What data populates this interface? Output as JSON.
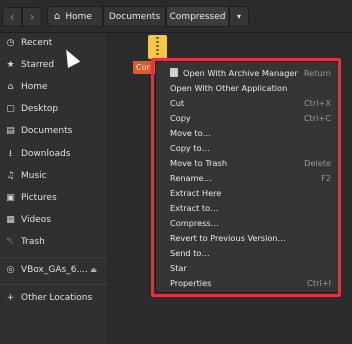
{
  "header": {
    "back_glyph": "‹",
    "forward_glyph": "›",
    "breadcrumbs": [
      {
        "label": "Home",
        "icon": "home-icon"
      },
      {
        "label": "Documents"
      },
      {
        "label": "Compressed"
      }
    ],
    "dropdown_glyph": "▾"
  },
  "sidebar": {
    "items": [
      {
        "label": "Recent",
        "icon": "clock-icon",
        "glyph": "◷"
      },
      {
        "label": "Starred",
        "icon": "star-icon",
        "glyph": "★"
      },
      {
        "label": "Home",
        "icon": "home-icon",
        "glyph": "⌂"
      },
      {
        "label": "Desktop",
        "icon": "desktop-icon",
        "glyph": "▢"
      },
      {
        "label": "Documents",
        "icon": "document-icon",
        "glyph": "▤"
      },
      {
        "label": "Downloads",
        "icon": "download-icon",
        "glyph": "⭳"
      },
      {
        "label": "Music",
        "icon": "music-icon",
        "glyph": "♫"
      },
      {
        "label": "Pictures",
        "icon": "picture-icon",
        "glyph": "▣"
      },
      {
        "label": "Videos",
        "icon": "video-icon",
        "glyph": "▦"
      },
      {
        "label": "Trash",
        "icon": "trash-icon",
        "glyph": "␡"
      }
    ],
    "device": {
      "label": "VBox_GAs_6....",
      "icon": "disc-icon",
      "glyph": "◎",
      "eject_glyph": "⏏"
    },
    "other_locations": {
      "label": "Other Locations",
      "glyph": "+"
    }
  },
  "content": {
    "selected_file_label": "Cor"
  },
  "context_menu": {
    "items": [
      {
        "label": "Open With Archive Manager",
        "shortcut": "Return",
        "icon": "archive-icon"
      },
      {
        "label": "Open With Other Application",
        "shortcut": ""
      },
      {
        "label": "Cut",
        "shortcut": "Ctrl+X"
      },
      {
        "label": "Copy",
        "shortcut": "Ctrl+C"
      },
      {
        "label": "Move to…",
        "shortcut": ""
      },
      {
        "label": "Copy to…",
        "shortcut": ""
      },
      {
        "label": "Move to Trash",
        "shortcut": "Delete"
      },
      {
        "label": "Rename…",
        "shortcut": "F2"
      },
      {
        "label": "Extract Here",
        "shortcut": ""
      },
      {
        "label": "Extract to…",
        "shortcut": ""
      },
      {
        "label": "Compress…",
        "shortcut": ""
      },
      {
        "label": "Revert to Previous Version…",
        "shortcut": ""
      },
      {
        "label": "Send to…",
        "shortcut": ""
      },
      {
        "label": "Star",
        "shortcut": ""
      },
      {
        "label": "Properties",
        "shortcut": "Ctrl+I"
      }
    ]
  },
  "colors": {
    "accent": "#e95420",
    "highlight_outline": "#e0323f",
    "zip_icon": "#f6c744"
  }
}
